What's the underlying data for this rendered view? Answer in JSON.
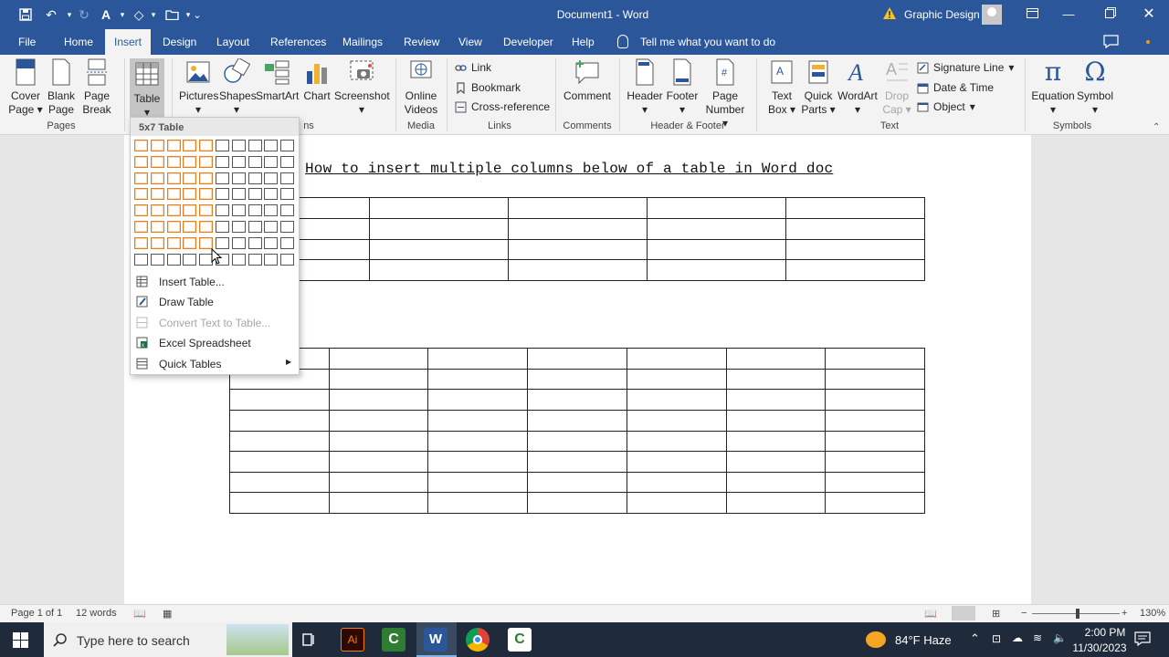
{
  "window": {
    "title": "Document1  -  Word",
    "user_name": "Graphic Design"
  },
  "tabs": [
    "File",
    "Home",
    "Insert",
    "Design",
    "Layout",
    "References",
    "Mailings",
    "Review",
    "View",
    "Developer",
    "Help"
  ],
  "active_tab": "Insert",
  "tell_me": "Tell me what you want to do",
  "ribbon": {
    "pages": {
      "cover_page": "Cover",
      "cover_page2": "Page",
      "blank_page": "Blank",
      "blank_page2": "Page",
      "page_break": "Page",
      "page_break2": "Break",
      "group": "Pages"
    },
    "tables": {
      "table": "Table"
    },
    "illustrations": {
      "pictures": "Pictures",
      "shapes": "Shapes",
      "smartart": "SmartArt",
      "chart": "Chart",
      "screenshot": "Screenshot",
      "group_tail": "ns"
    },
    "media": {
      "online_videos": "Online",
      "online_videos2": "Videos",
      "group": "Media"
    },
    "links": {
      "link": "Link",
      "bookmark": "Bookmark",
      "cross_reference": "Cross-reference",
      "group": "Links"
    },
    "comments": {
      "comment": "Comment",
      "group": "Comments"
    },
    "header_footer": {
      "header": "Header",
      "footer": "Footer",
      "page_number": "Page",
      "page_number2": "Number",
      "group": "Header & Footer"
    },
    "text": {
      "text_box": "Text",
      "text_box2": "Box",
      "quick_parts": "Quick",
      "quick_parts2": "Parts",
      "wordart": "WordArt",
      "drop_cap": "Drop",
      "drop_cap2": "Cap",
      "signature_line": "Signature Line",
      "date_time": "Date & Time",
      "object": "Object",
      "group": "Text"
    },
    "symbols": {
      "equation": "Equation",
      "symbol": "Symbol",
      "group": "Symbols"
    }
  },
  "dropdown": {
    "header": "5x7 Table",
    "grid_cols": 10,
    "grid_rows": 8,
    "selected_cols": 5,
    "selected_rows": 7,
    "items": [
      {
        "label": "Insert Table...",
        "disabled": false
      },
      {
        "label": "Draw Table",
        "disabled": false
      },
      {
        "label": "Convert Text to Table...",
        "disabled": true
      },
      {
        "label": "Excel Spreadsheet",
        "disabled": false
      },
      {
        "label": "Quick Tables",
        "disabled": false
      }
    ]
  },
  "document": {
    "heading": "How to insert multiple columns below of a table in Word doc",
    "table1": {
      "rows": 4,
      "cols": 5
    },
    "table2": {
      "rows": 8,
      "cols": 7
    }
  },
  "statusbar": {
    "page": "Page 1 of 1",
    "words": "12 words",
    "zoom": "130%"
  },
  "taskbar": {
    "search_placeholder": "Type here to search",
    "weather": "84°F  Haze",
    "time": "2:00 PM",
    "date": "11/30/2023"
  },
  "colors": {
    "word_blue": "#2b579a",
    "selection_orange": "#e67e22",
    "ribbon_bg": "#f3f3f3"
  }
}
